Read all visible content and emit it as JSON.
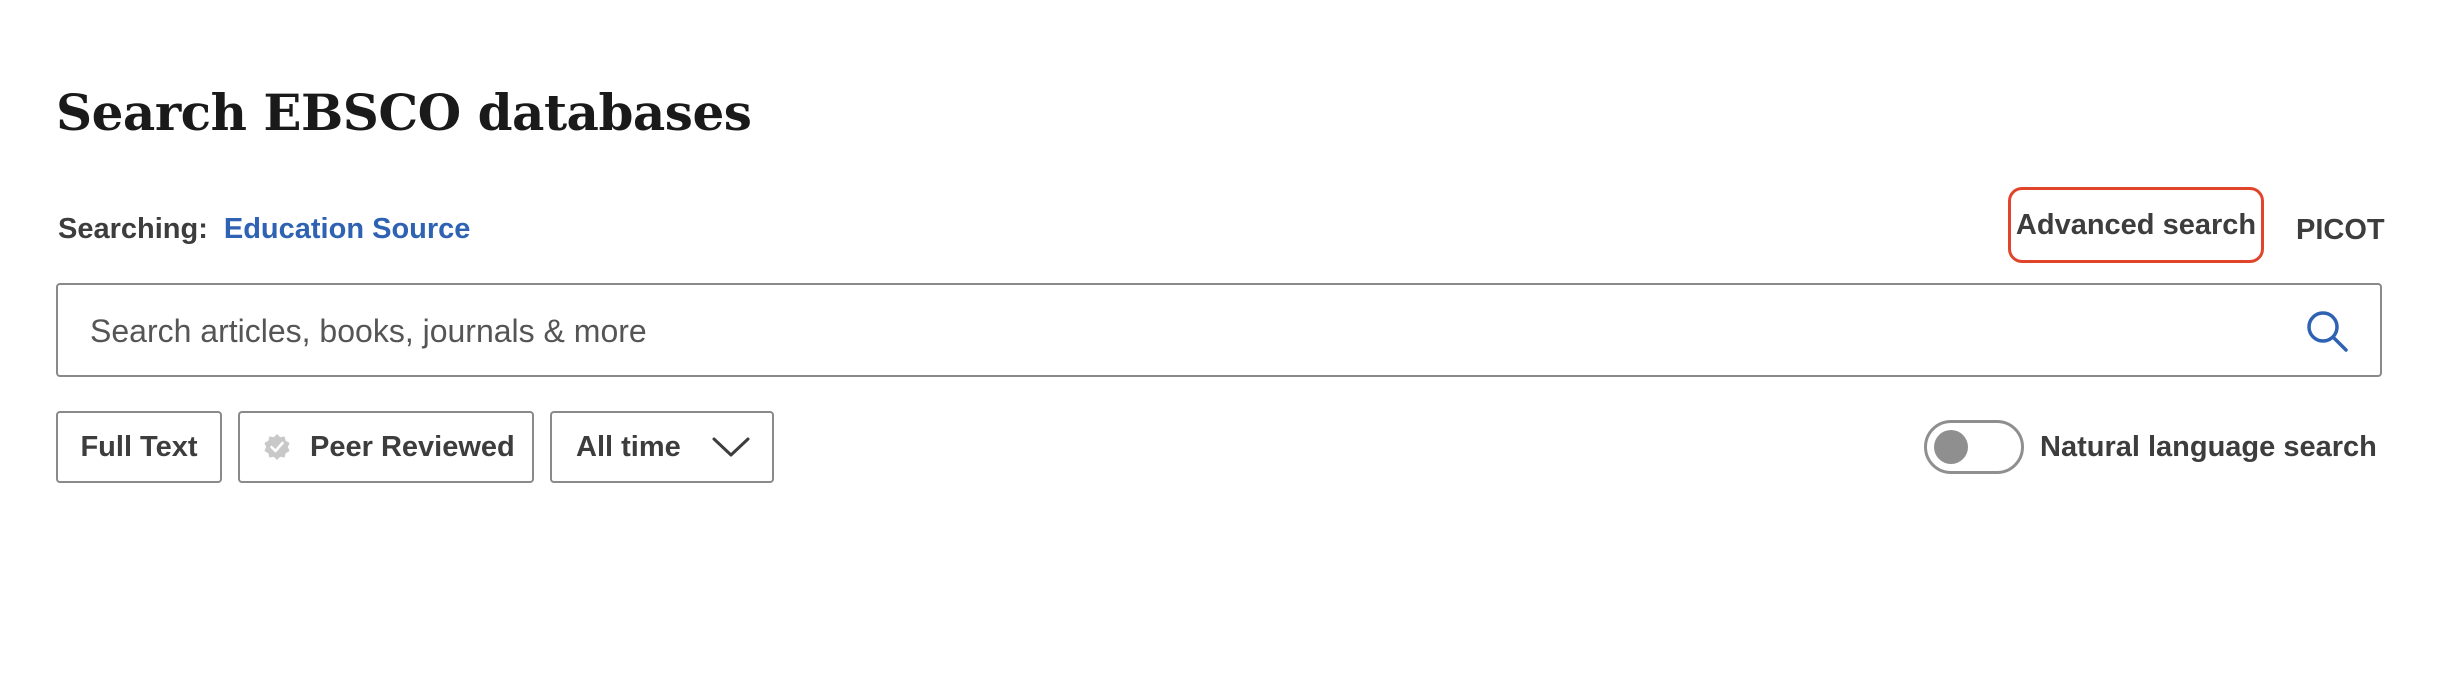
{
  "page": {
    "title": "Search EBSCO databases"
  },
  "scope": {
    "label": "Searching:",
    "database": "Education Source"
  },
  "links": {
    "advanced_search": "Advanced search",
    "picot": "PICOT"
  },
  "search": {
    "placeholder": "Search articles, books, journals & more",
    "value": "",
    "icon": "search-icon"
  },
  "filters": {
    "full_text": "Full Text",
    "peer_reviewed": "Peer Reviewed",
    "peer_reviewed_icon": "verified-badge-icon",
    "date_range": "All time",
    "date_range_icon": "chevron-down-icon"
  },
  "natural_language": {
    "label": "Natural language search",
    "enabled": false
  },
  "colors": {
    "accent_link": "#2f62b3",
    "highlight_border": "#e0452c",
    "border_gray": "#8a8a8a",
    "text_dark": "#3d3d3d"
  }
}
